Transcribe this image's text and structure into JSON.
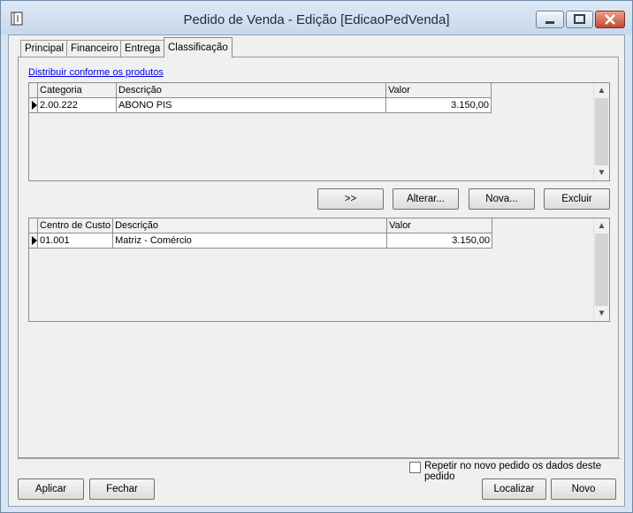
{
  "window": {
    "title": "Pedido de Venda - Edição [EdicaoPedVenda]"
  },
  "tabs": [
    "Principal",
    "Financeiro",
    "Entrega",
    "Classificação"
  ],
  "link": "Distribuir conforme os produtos",
  "grid1": {
    "headers": [
      "Categoria",
      "Descrição",
      "Valor"
    ],
    "rows": [
      [
        "2.00.222",
        "ABONO PIS",
        "3.150,00"
      ]
    ]
  },
  "buttons_mid": [
    ">>",
    "Alterar...",
    "Nova...",
    "Excluir"
  ],
  "grid2": {
    "headers": [
      "Centro de Custo",
      "Descrição",
      "Valor"
    ],
    "rows": [
      [
        "01.001",
        "Matriz - Comércio",
        "3.150,00"
      ]
    ]
  },
  "checkbox_label": "Repetir no novo pedido os dados deste pedido",
  "buttons_bottom": [
    "Aplicar",
    "Fechar",
    "Localizar",
    "Novo"
  ]
}
